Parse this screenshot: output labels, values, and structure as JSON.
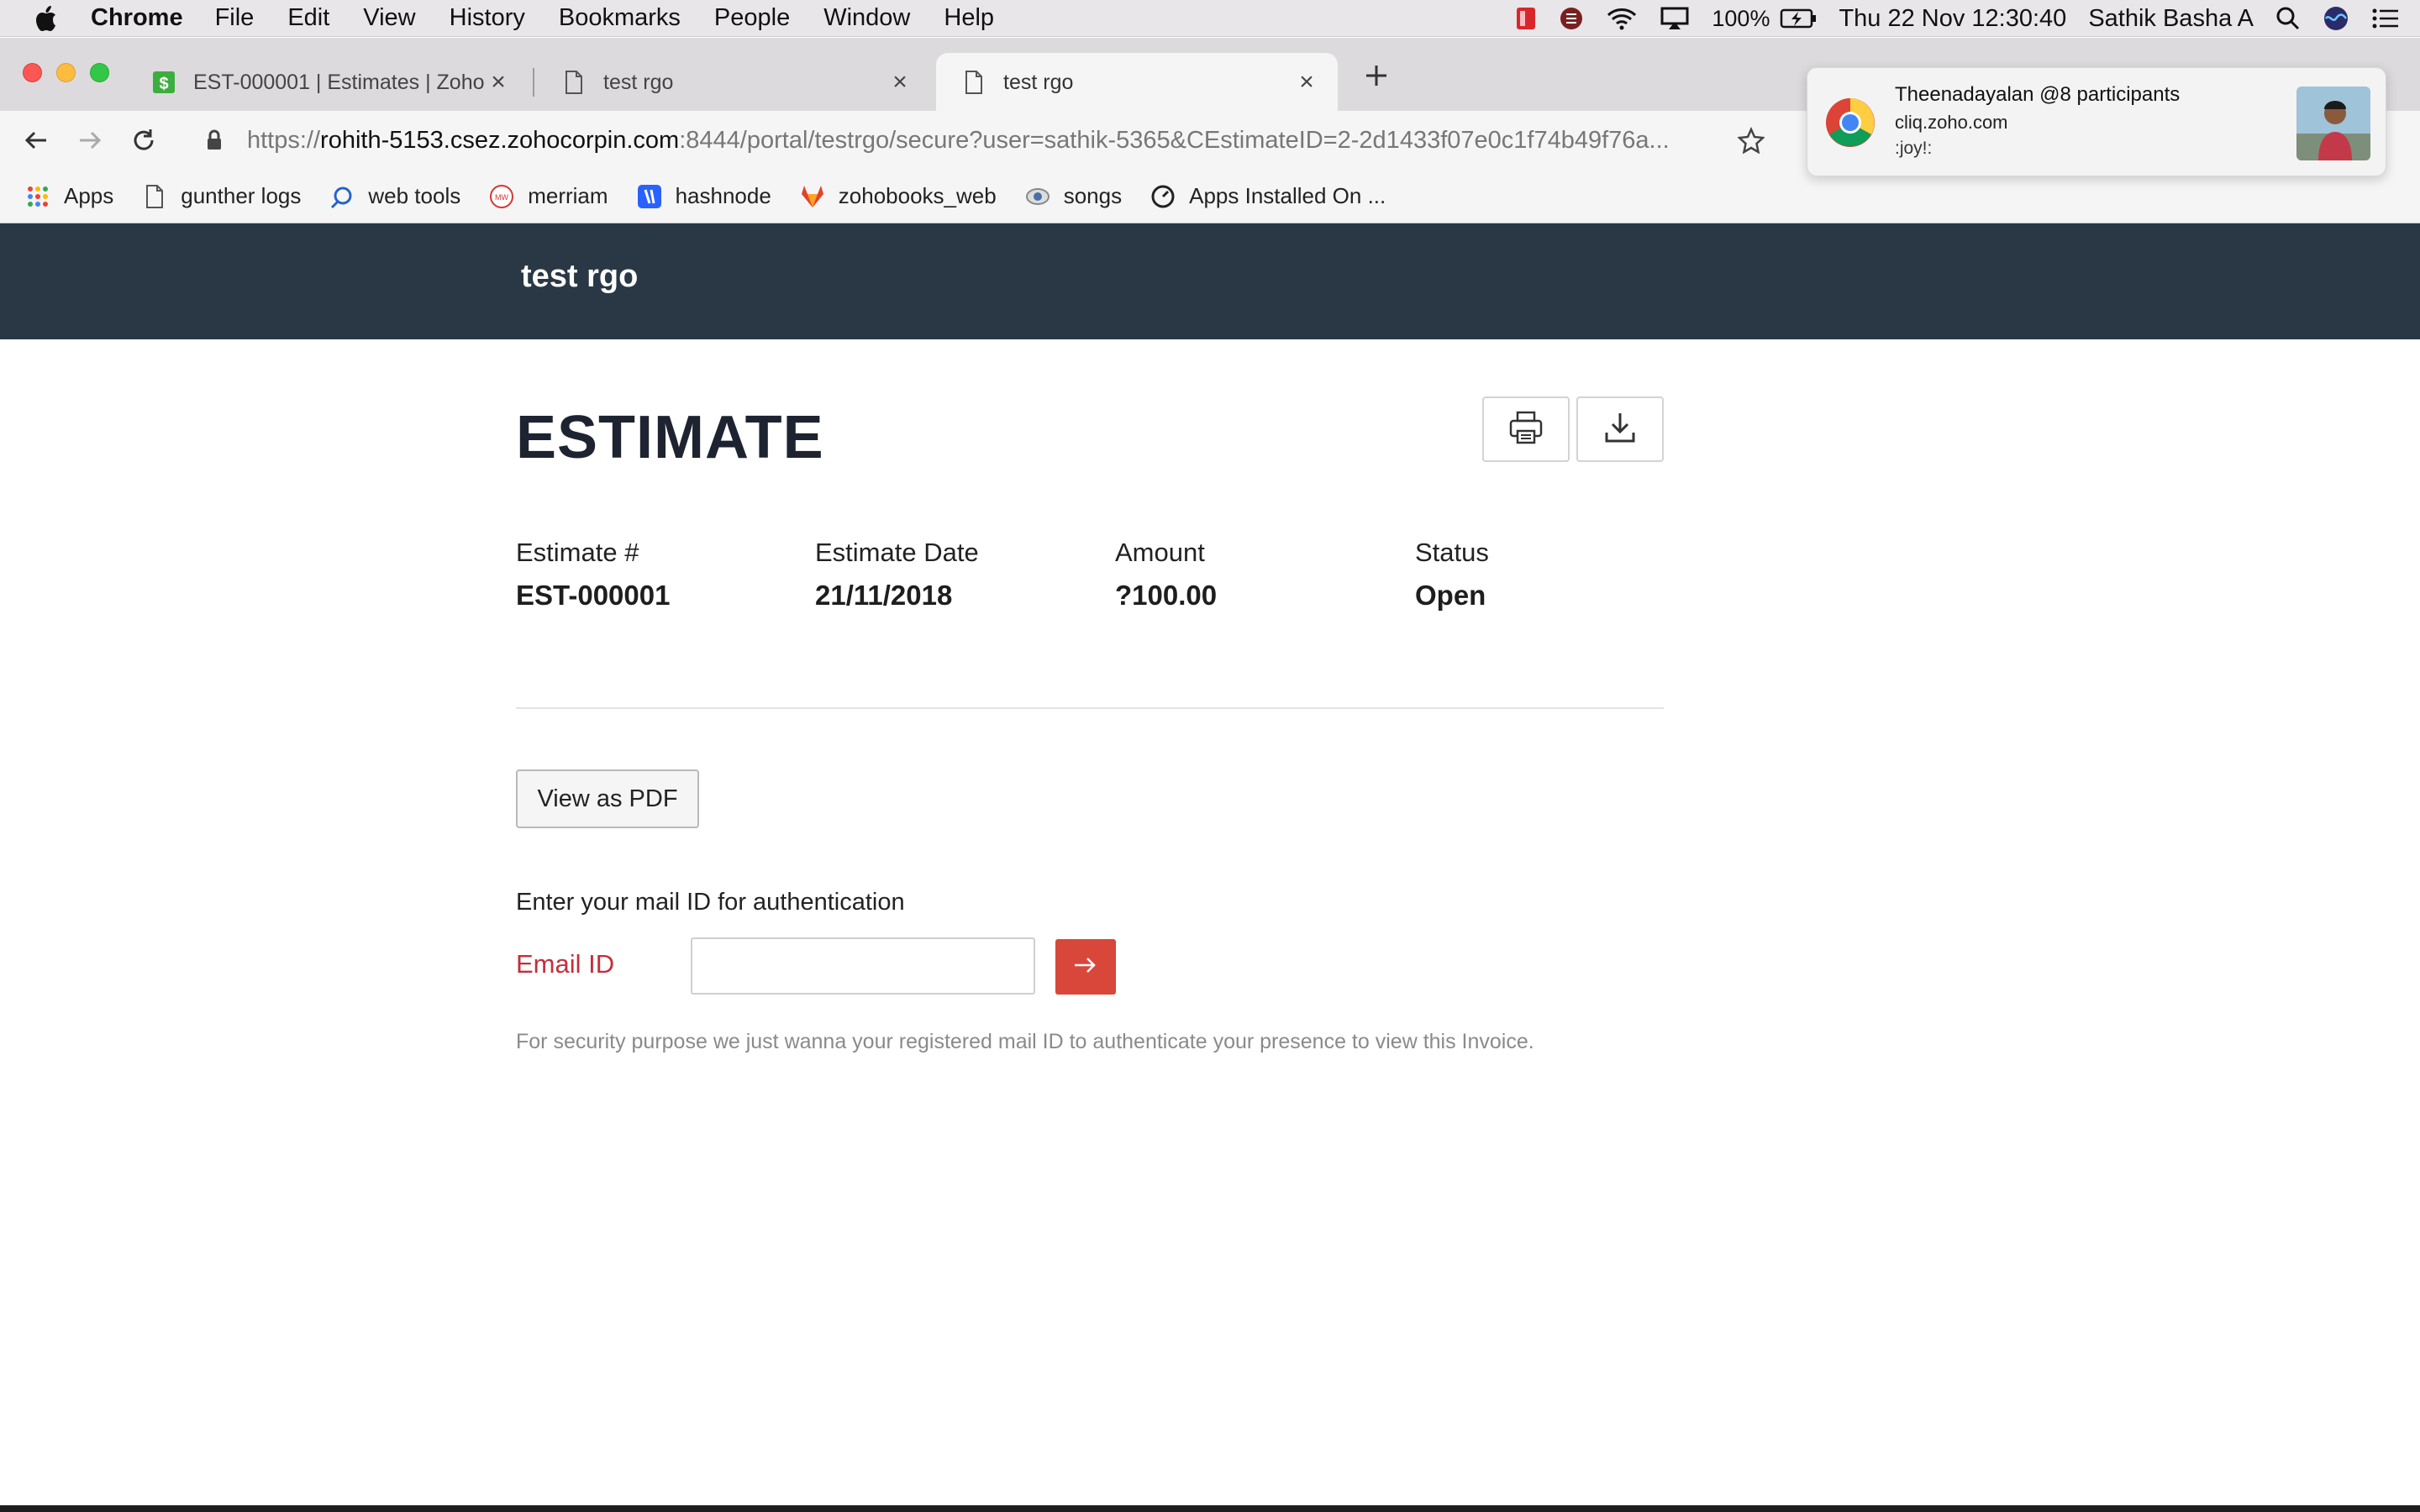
{
  "menubar": {
    "app_name": "Chrome",
    "items": [
      "File",
      "Edit",
      "View",
      "History",
      "Bookmarks",
      "People",
      "Window",
      "Help"
    ],
    "battery": "100%",
    "datetime": "Thu 22 Nov  12:30:40",
    "user": "Sathik Basha A"
  },
  "tabs": [
    {
      "title": "EST-000001 | Estimates | Zoho",
      "icon": "zoho-books-icon"
    },
    {
      "title": "test rgo",
      "icon": "page-icon"
    },
    {
      "title": "test rgo",
      "icon": "page-icon",
      "active": true
    }
  ],
  "omnibox": {
    "scheme": "https://",
    "host": "rohith-5153.csez.zohocorpin.com",
    "path": ":8444/portal/testrgo/secure?user=sathik-5365&CEstimateID=2-2d1433f07e0c1f74b49f76a..."
  },
  "bookmarks": [
    {
      "label": "Apps",
      "icon": "apps-grid-icon"
    },
    {
      "label": "gunther logs",
      "icon": "page-icon"
    },
    {
      "label": "web tools",
      "icon": "web-tools-icon"
    },
    {
      "label": "merriam",
      "icon": "merriam-icon"
    },
    {
      "label": "hashnode",
      "icon": "hashnode-icon"
    },
    {
      "label": "zohobooks_web",
      "icon": "gitlab-icon"
    },
    {
      "label": "songs",
      "icon": "songs-icon"
    },
    {
      "label": "Apps Installed On ...",
      "icon": "gauge-icon"
    }
  ],
  "notification": {
    "title": "Theenadayalan @8 participants",
    "source": "cliq.zoho.com",
    "message": ":joy!:"
  },
  "portal": {
    "brand": "test rgo"
  },
  "estimate": {
    "heading": "ESTIMATE",
    "fields": [
      {
        "label": "Estimate #",
        "value": "EST-000001"
      },
      {
        "label": "Estimate Date",
        "value": "21/11/2018"
      },
      {
        "label": "Amount",
        "value": "?100.00"
      },
      {
        "label": "Status",
        "value": "Open"
      }
    ],
    "view_pdf_label": "View as PDF"
  },
  "auth": {
    "prompt": "Enter your mail ID for authentication",
    "email_label": "Email ID",
    "email_value": "",
    "note": "For security purpose we just wanna your registered mail ID to authenticate your presence to view this Invoice."
  },
  "colors": {
    "header_bg": "#2a3846",
    "accent_red": "#d8473a",
    "label_red": "#c2303a"
  }
}
